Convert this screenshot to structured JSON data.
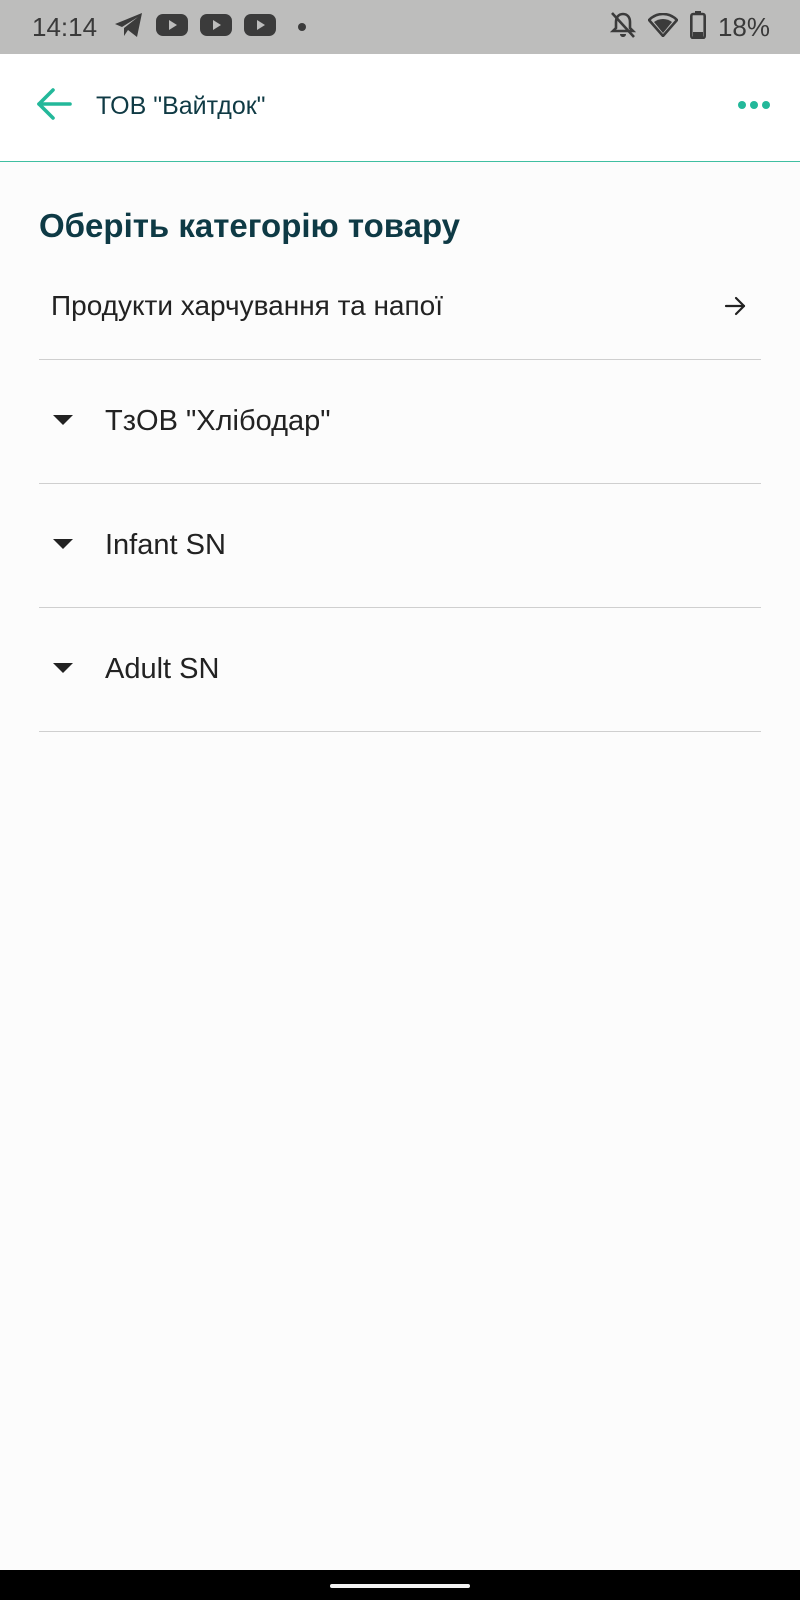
{
  "status_bar": {
    "time": "14:14",
    "left_icons": [
      "telegram-icon",
      "youtube-icon",
      "youtube-icon",
      "youtube-icon",
      "dot-icon"
    ],
    "right_icons": [
      "bell-off-icon",
      "wifi-icon",
      "battery-icon"
    ],
    "battery": "18%"
  },
  "app_bar": {
    "title": "ТОВ \"Вайтдок\"",
    "back_icon": "arrow-left-icon",
    "more_icon": "more-horizontal-icon",
    "accent_color": "#23b89a"
  },
  "main": {
    "heading": "Оберіть категорію товару",
    "category": {
      "label": "Продукти харчування та напої",
      "icon": "arrow-right-icon"
    },
    "groups": [
      {
        "label": "ТзОВ \"Хлібодар\"",
        "icon": "caret-down-icon"
      },
      {
        "label": "Infant SN",
        "icon": "caret-down-icon"
      },
      {
        "label": "Adult SN",
        "icon": "caret-down-icon"
      }
    ]
  }
}
